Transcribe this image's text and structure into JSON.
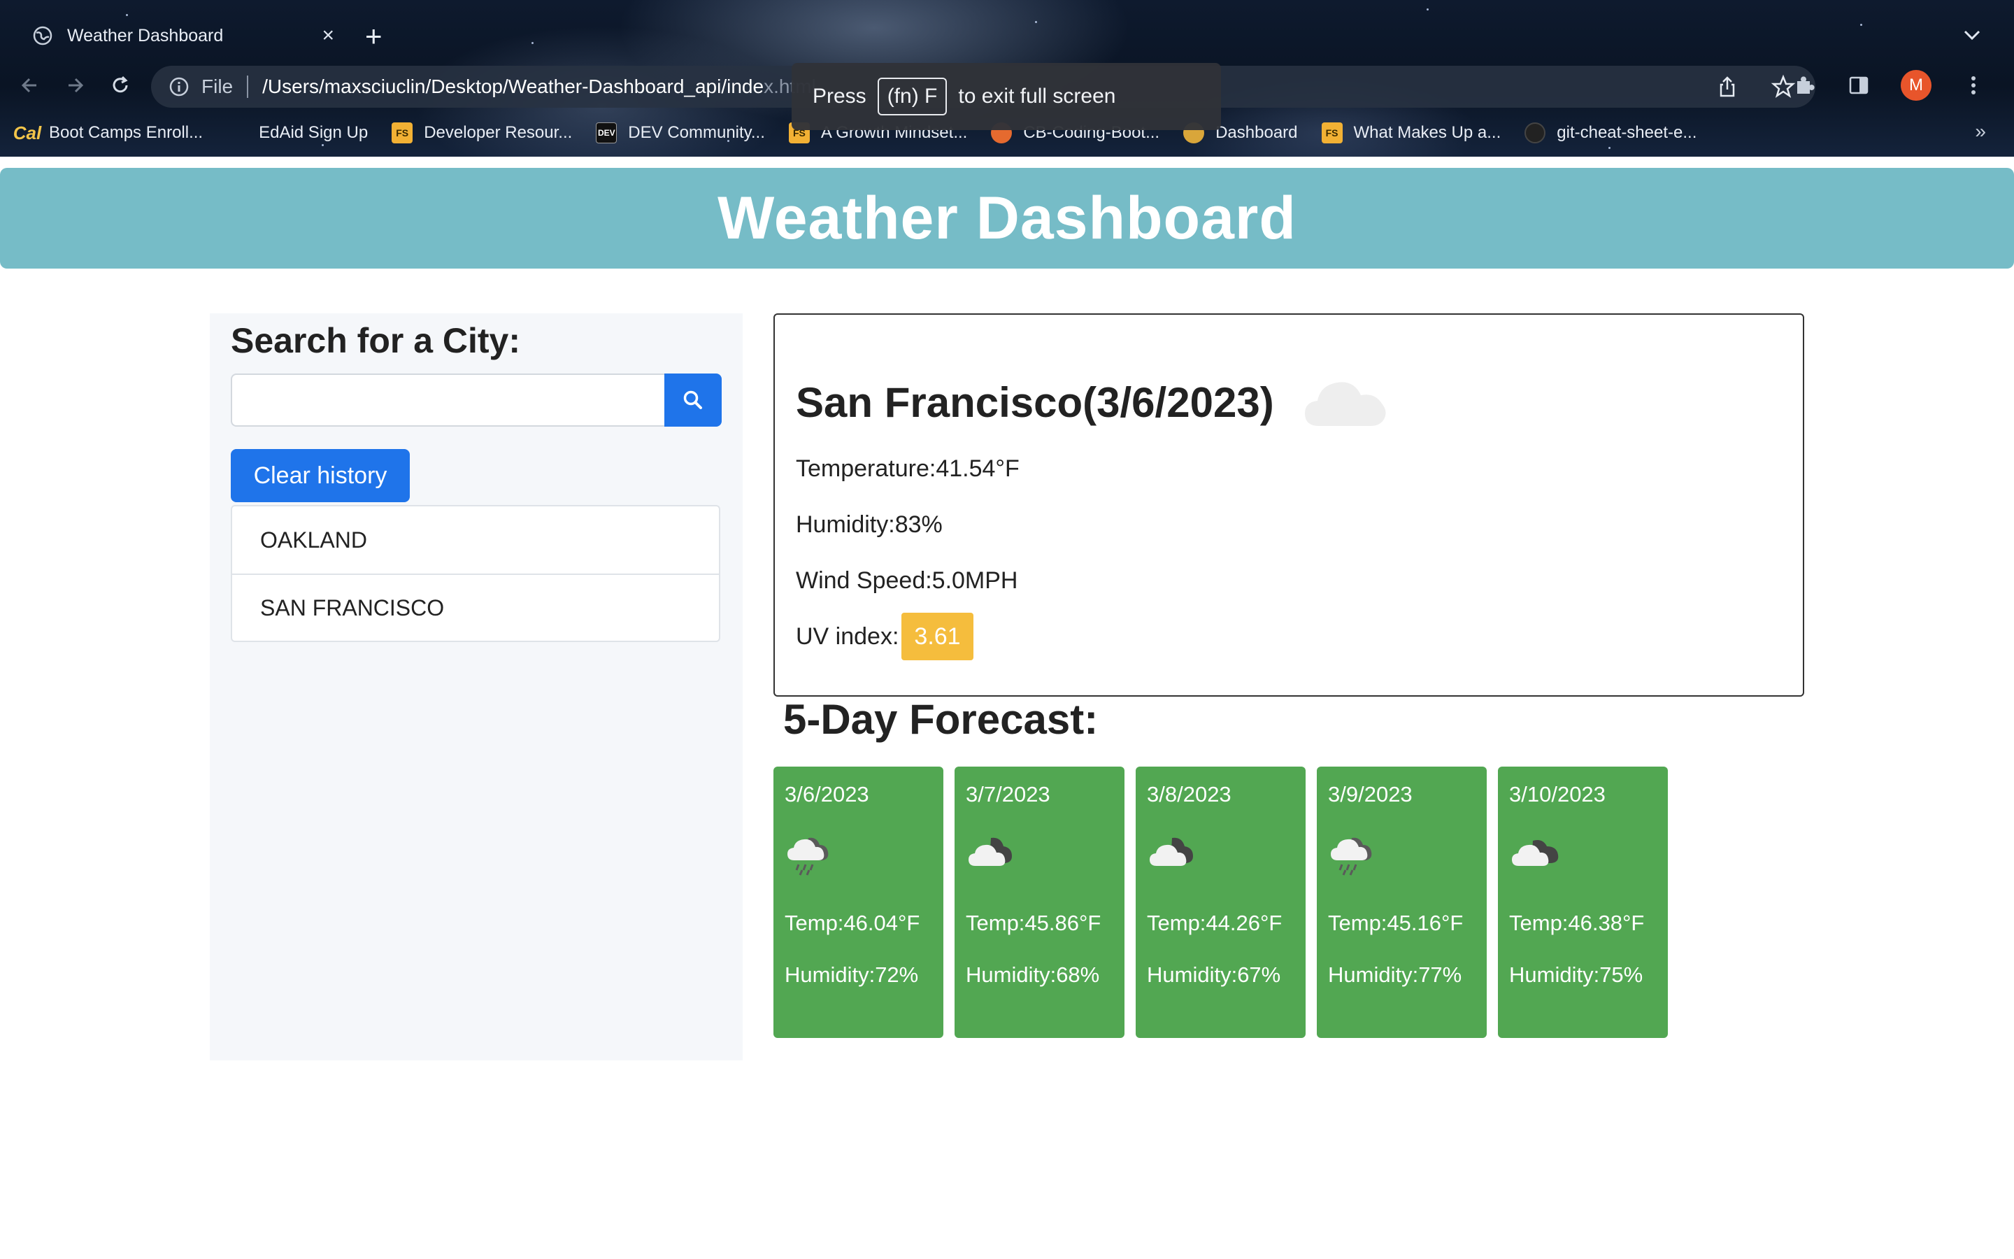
{
  "browser": {
    "tab_title": "Weather Dashboard",
    "close_glyph": "×",
    "new_tab_glyph": "+",
    "address": {
      "scheme_label": "File",
      "url": "/Users/maxsciuclin/Desktop/Weather-Dashboard_api/inde",
      "url_dim": "x.html"
    },
    "avatar_letter": "M",
    "bookmarks": [
      {
        "label": "Boot Camps Enroll...",
        "icon": "cal-icon"
      },
      {
        "label": "EdAid Sign Up",
        "icon": "none"
      },
      {
        "label": "Developer Resour...",
        "icon": "fs-icon"
      },
      {
        "label": "DEV Community...",
        "icon": "dev-icon"
      },
      {
        "label": "A Growth Mindset...",
        "icon": "fs-icon"
      },
      {
        "label": "CB-Coding-Boot...",
        "icon": "cb-icon"
      },
      {
        "label": "Dashboard",
        "icon": "dashboard-icon"
      },
      {
        "label": "What Makes Up a...",
        "icon": "fs-icon"
      },
      {
        "label": "git-cheat-sheet-e...",
        "icon": "github-icon"
      }
    ],
    "bookmarks_more": "»",
    "fullscreen_toast": {
      "press": "Press",
      "key": "(fn) F",
      "rest": "to exit full screen"
    }
  },
  "header": {
    "title": "Weather Dashboard"
  },
  "search": {
    "heading": "Search for a City:",
    "input_value": "",
    "input_placeholder": "",
    "clear_label": "Clear history",
    "history": [
      "OAKLAND",
      "SAN FRANCISCO"
    ]
  },
  "current": {
    "city_heading": "San Francisco(3/6/2023)",
    "icon": "cloud-icon",
    "temperature": "Temperature:41.54°F",
    "humidity": "Humidity:83%",
    "wind": "Wind Speed:5.0MPH",
    "uv_label": "UV index:",
    "uv_value": "3.61",
    "uv_color": "#f5bd3d"
  },
  "forecast": {
    "heading": "5-Day Forecast:",
    "card_color": "#52a752",
    "days": [
      {
        "date": "3/6/2023",
        "icon": "rain-cloud-icon",
        "temp": "Temp:46.04°F",
        "humidity": "Humidity:72%"
      },
      {
        "date": "3/7/2023",
        "icon": "cloudy-night-icon",
        "temp": "Temp:45.86°F",
        "humidity": "Humidity:68%"
      },
      {
        "date": "3/8/2023",
        "icon": "cloudy-night-icon",
        "temp": "Temp:44.26°F",
        "humidity": "Humidity:67%"
      },
      {
        "date": "3/9/2023",
        "icon": "rain-cloud-icon",
        "temp": "Temp:45.16°F",
        "humidity": "Humidity:77%"
      },
      {
        "date": "3/10/2023",
        "icon": "broken-clouds-icon",
        "temp": "Temp:46.38°F",
        "humidity": "Humidity:75%"
      }
    ]
  }
}
